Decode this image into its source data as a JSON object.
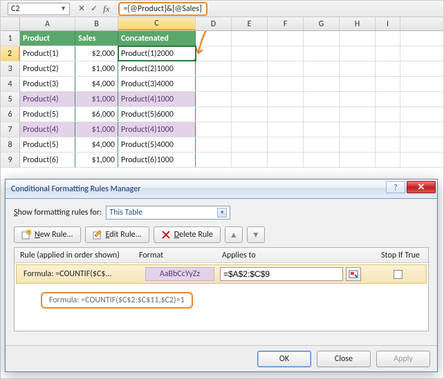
{
  "formula_bar": {
    "cell_ref": "C2",
    "formula": "=[@Product]&[@Sales]"
  },
  "columns": [
    "A",
    "B",
    "C",
    "D",
    "E",
    "F",
    "G",
    "H",
    "I"
  ],
  "row_numbers": [
    "1",
    "2",
    "3",
    "4",
    "5",
    "6",
    "7",
    "8",
    "9"
  ],
  "table": {
    "headers": {
      "product": "Product",
      "sales": "Sales",
      "concat": "Concatenated"
    },
    "rows": [
      {
        "product": "Product(1)",
        "sales": "$2,000",
        "concat": "Product(1)2000",
        "stripe": false
      },
      {
        "product": "Product(2)",
        "sales": "$1,000",
        "concat": "Product(2)1000",
        "stripe": false
      },
      {
        "product": "Product(3)",
        "sales": "$4,000",
        "concat": "Product(3)4000",
        "stripe": false
      },
      {
        "product": "Product(4)",
        "sales": "$1,000",
        "concat": "Product(4)1000",
        "stripe": true
      },
      {
        "product": "Product(5)",
        "sales": "$6,000",
        "concat": "Product(5)6000",
        "stripe": false
      },
      {
        "product": "Product(4)",
        "sales": "$1,000",
        "concat": "Product(4)1000",
        "stripe": true
      },
      {
        "product": "Product(5)",
        "sales": "$4,000",
        "concat": "Product(5)4000",
        "stripe": false
      },
      {
        "product": "Product(6)",
        "sales": "$1,000",
        "concat": "Product(6)1000",
        "stripe": false
      }
    ]
  },
  "dialog": {
    "title": "Conditional Formatting Rules Manager",
    "show_rules_label_1": "S",
    "show_rules_label_2": "how formatting rules for:",
    "scope": "This Table",
    "buttons": {
      "new_u": "N",
      "new_rest": "ew Rule...",
      "edit_u": "E",
      "edit_rest": "dit Rule...",
      "del_u": "D",
      "del_rest": "elete Rule"
    },
    "headers": {
      "rule": "Rule (applied in order shown)",
      "format": "Format",
      "applies": "Applies to",
      "stop": "Stop If True"
    },
    "rule": {
      "label": "Formula: =COUNTIF($C$...",
      "preview": "AaBbCcYyZz",
      "applies_to": "=$A$2:$C$9"
    },
    "full_formula": "Formula: =COUNTIF($C$2:$C$11,$C2)>1",
    "footer": {
      "ok": "OK",
      "close": "Close",
      "apply": "Apply"
    }
  }
}
